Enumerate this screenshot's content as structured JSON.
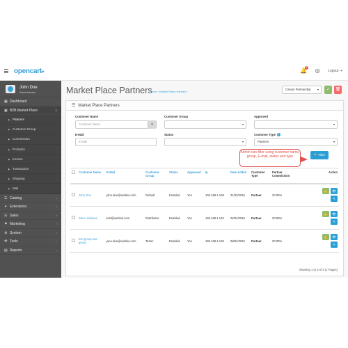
{
  "header": {
    "logo": "opencart",
    "logo_cart": "➡🛒",
    "alert_count": "8",
    "logout": "Logout"
  },
  "sidebar": {
    "user_name": "John Doe",
    "user_role": "Administrator",
    "items": [
      {
        "label": "Dashboard",
        "icon": "▣"
      },
      {
        "label": "B2B Market Place",
        "icon": "▣",
        "caret": "∨"
      }
    ],
    "sub_items": [
      {
        "label": "Partners"
      },
      {
        "label": "Customer Group"
      },
      {
        "label": "Commission"
      },
      {
        "label": "Products"
      },
      {
        "label": "Income"
      },
      {
        "label": "Transaction"
      },
      {
        "label": "Shipping"
      },
      {
        "label": "Mail"
      }
    ],
    "items_bottom": [
      {
        "label": "Catalog",
        "icon": "☰",
        "caret": "›"
      },
      {
        "label": "Extensions",
        "icon": "✦",
        "caret": "›"
      },
      {
        "label": "Sales",
        "icon": "☲",
        "caret": "›"
      },
      {
        "label": "Marketing",
        "icon": "⚑",
        "caret": "›"
      },
      {
        "label": "System",
        "icon": "⚙",
        "caret": "›"
      },
      {
        "label": "Tools",
        "icon": "⚒",
        "caret": "›"
      },
      {
        "label": "Reports",
        "icon": "▤",
        "caret": "›"
      }
    ]
  },
  "page": {
    "title": "Market Place Partners",
    "breadcrumb": [
      "Home",
      "Market Place Partners"
    ],
    "header_select": "Cancel Partnership"
  },
  "panel": {
    "title": "Market Place Partners"
  },
  "filter": {
    "customer_name_label": "Customer Name",
    "customer_name_placeholder": "Customer Name",
    "customer_group_label": "Customer Group",
    "approved_label": "Approved",
    "email_label": "E-Mail",
    "email_placeholder": "E-Mail",
    "status_label": "Status",
    "customer_type_label": "Customer Type",
    "customer_type_value": "Partners",
    "filter_button": "Filter"
  },
  "callout": {
    "text": "Admin can filter using customer name, group, E-mail, status and type"
  },
  "table": {
    "columns": [
      "Customer Name",
      "E-Mail",
      "Customer Group",
      "Status",
      "Approved",
      "Ip",
      "Date Added",
      "Customer Type",
      "Partner Commission",
      "Action"
    ],
    "rows": [
      {
        "name": "John Doe",
        "email": "john.doe@webkul.com",
        "group": "Default",
        "status": "Enabled",
        "approved": "Yes",
        "ip": "192.168.1.108",
        "date": "31/03/2015",
        "type": "Partner",
        "commission": "20.00%"
      },
      {
        "name": "Steve mirkena",
        "email": "test@webkul.com",
        "group": "Distributor",
        "status": "Enabled",
        "approved": "Yes",
        "ip": "192.168.1.132",
        "date": "02/04/2015",
        "type": "Partner",
        "commission": "20.00%"
      },
      {
        "name": "test group test group",
        "email": "jane.doe@webkul.com",
        "group": "Tester",
        "status": "Enabled",
        "approved": "Yes",
        "ip": "192.168.1.125",
        "date": "08/04/2015",
        "type": "Partner",
        "commission": "20.00%"
      }
    ],
    "showing": "Showing 1 to 3 of 3 (1 Pages)"
  },
  "colors": {
    "accent": "#3aa0d9",
    "sidebar": "#515151",
    "success": "#8fbb6c",
    "danger": "#f56b6b",
    "callout": "#e0504b"
  }
}
